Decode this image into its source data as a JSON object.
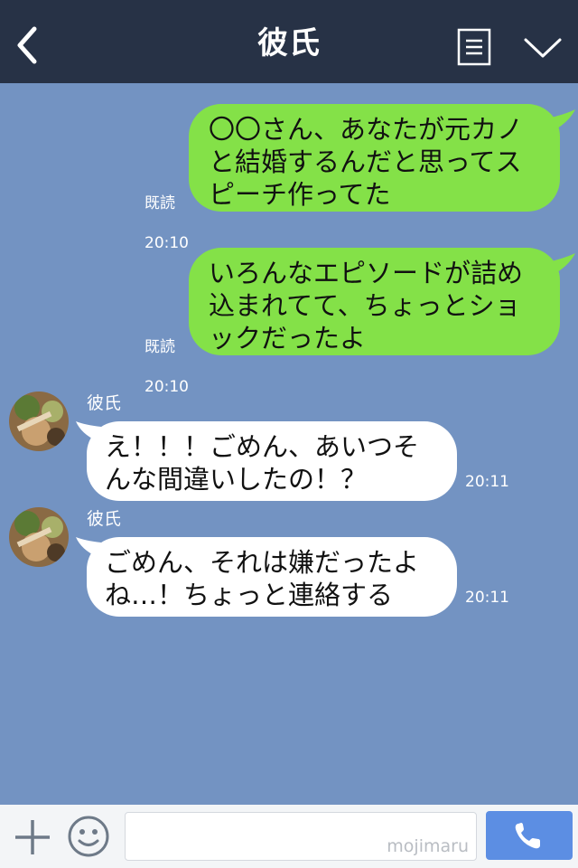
{
  "header": {
    "title": "彼氏"
  },
  "messages": [
    {
      "direction": "sent",
      "text": "〇〇さん、あなたが元カノ\nと結婚するんだと思ってス\nピーチ作ってた",
      "read": "既読",
      "time": "20:10"
    },
    {
      "direction": "sent",
      "text": "いろんなエピソードが詰め\n込まれてて、ちょっとショ\nックだったよ",
      "read": "既読",
      "time": "20:10"
    },
    {
      "direction": "received",
      "sender": "彼氏",
      "text": "え！！！ごめん、あいつそ\nんな間違いしたの！？",
      "time": "20:11"
    },
    {
      "direction": "received",
      "sender": "彼氏",
      "text": "ごめん、それは嫌だったよ\nね…！ちょっと連絡する",
      "time": "20:11"
    }
  ],
  "footer": {
    "watermark": "mojimaru"
  },
  "colors": {
    "header_bg": "#273246",
    "chat_bg": "#7393c2",
    "sent_bubble": "#84e148",
    "received_bubble": "#ffffff",
    "call_button": "#5c8ee3"
  }
}
